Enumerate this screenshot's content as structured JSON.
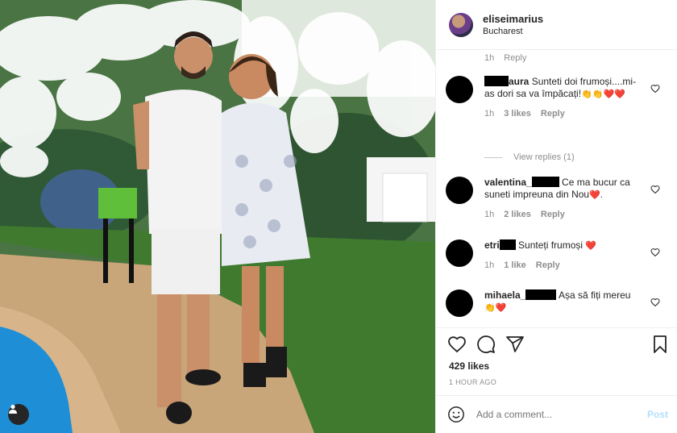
{
  "post": {
    "username": "eliseimarius",
    "location": "Bucharest"
  },
  "previous_comment": {
    "time": "1h",
    "reply_label": "Reply"
  },
  "comments": [
    {
      "user": "aura",
      "text": "Sunteti doi frumoși....mi- as dori sa va împăcați!",
      "emoji": "👏👏❤️❤️",
      "time": "1h",
      "likes": "3 likes",
      "reply_label": "Reply"
    },
    {
      "user": "valentina_",
      "text": "Ce ma bucur ca suneti impreuna din Nou",
      "emoji": "❤️.",
      "time": "1h",
      "likes": "2 likes",
      "reply_label": "Reply"
    },
    {
      "user": "etri",
      "text": "Sunteți frumoși",
      "emoji": "❤️",
      "time": "1h",
      "likes": "1 like",
      "reply_label": "Reply"
    },
    {
      "user": "mihaela_",
      "text": "Așa să fiți mereu",
      "emoji": "👏❤️",
      "time": "",
      "likes": "",
      "reply_label": ""
    }
  ],
  "view_replies": "View replies (1)",
  "actions": {
    "likes": "429 likes",
    "time_ago": "1 HOUR AGO"
  },
  "add_comment": {
    "placeholder": "Add a comment...",
    "post_label": "Post"
  },
  "colors": {
    "post_button_disabled": "#b2dffc",
    "meta_gray": "#8e8e8e",
    "heart_red": "#ed4956"
  },
  "icons": [
    "user-tag-icon",
    "heart-icon",
    "comment-icon",
    "share-icon",
    "bookmark-icon",
    "emoji-icon",
    "like-comment-icon"
  ]
}
